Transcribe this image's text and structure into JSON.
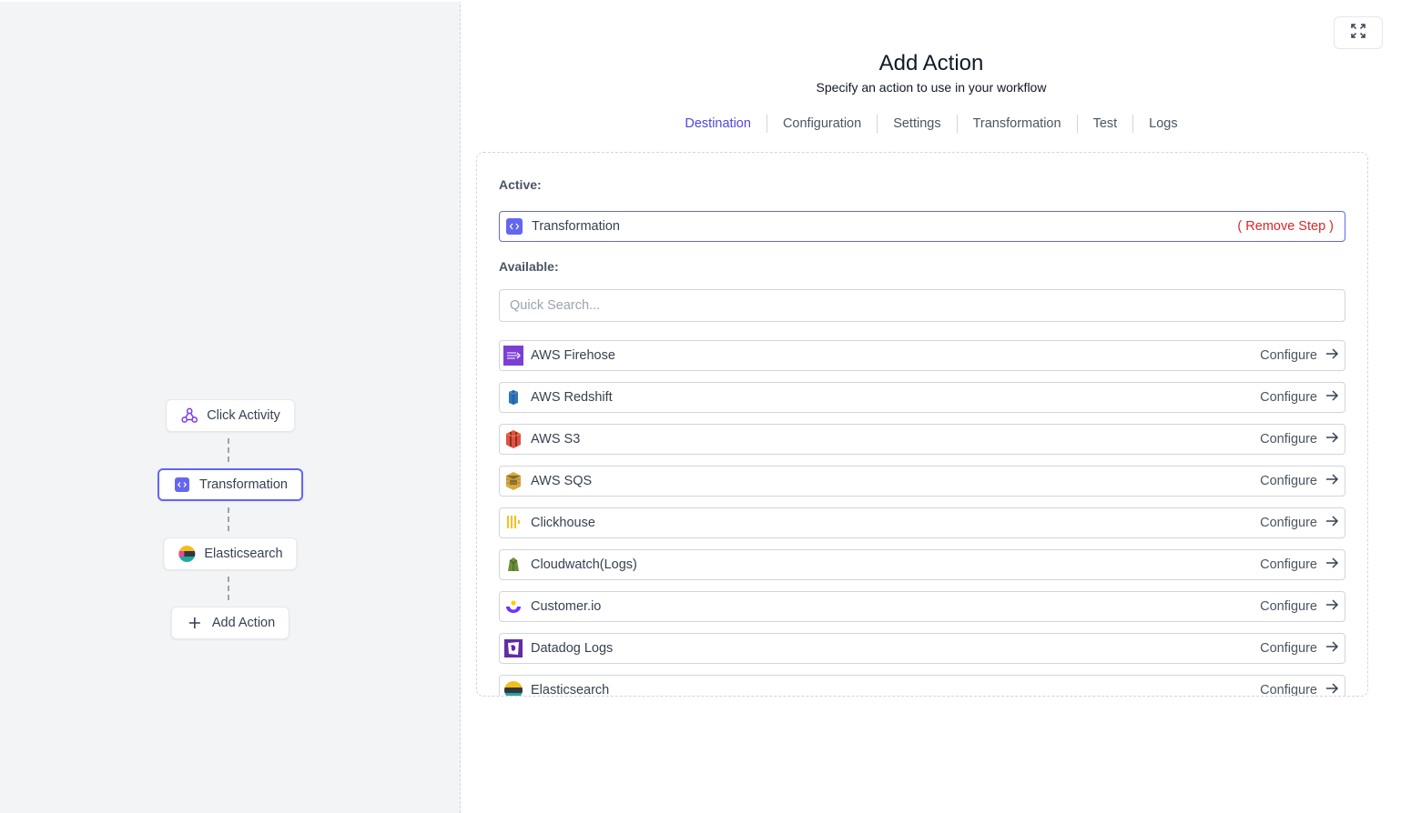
{
  "flow": {
    "nodes": [
      {
        "label": "Click Activity",
        "icon": "webhook-icon"
      },
      {
        "label": "Transformation",
        "icon": "code-icon"
      },
      {
        "label": "Elasticsearch",
        "icon": "elasticsearch-icon"
      },
      {
        "label": "Add Action",
        "icon": "plus-icon"
      }
    ]
  },
  "panel": {
    "title": "Add Action",
    "subtitle": "Specify an action to use in your workflow",
    "tabs": [
      "Destination",
      "Configuration",
      "Settings",
      "Transformation",
      "Test",
      "Logs"
    ],
    "selected_tab": "Destination",
    "active_label": "Active:",
    "active_step": {
      "name": "Transformation",
      "action": "( Remove Step )"
    },
    "available_label": "Available:",
    "search_placeholder": "Quick Search...",
    "configure_label": "Configure",
    "destinations": [
      {
        "name": "AWS Firehose",
        "icon": "aws-firehose-icon"
      },
      {
        "name": "AWS Redshift",
        "icon": "aws-redshift-icon"
      },
      {
        "name": "AWS S3",
        "icon": "aws-s3-icon"
      },
      {
        "name": "AWS SQS",
        "icon": "aws-sqs-icon"
      },
      {
        "name": "Clickhouse",
        "icon": "clickhouse-icon"
      },
      {
        "name": "Cloudwatch(Logs)",
        "icon": "cloudwatch-icon"
      },
      {
        "name": "Customer.io",
        "icon": "customerio-icon"
      },
      {
        "name": "Datadog Logs",
        "icon": "datadog-icon"
      },
      {
        "name": "Elasticsearch",
        "icon": "elasticsearch-icon"
      }
    ]
  },
  "colors": {
    "accent": "#6366f1",
    "danger": "#dc2626",
    "canvas": "#f3f4f6"
  }
}
